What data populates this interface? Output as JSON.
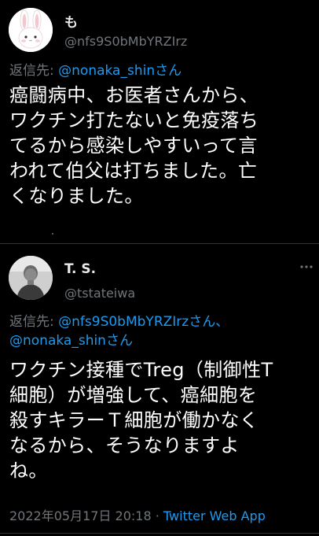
{
  "tweets": [
    {
      "display_name": "も",
      "handle": "@nfs9S0bMbYRZIrz",
      "reply_prefix": "返信先: ",
      "reply_mentions": "@nonaka_shinさん",
      "reply_mentions_2": "",
      "text": "癌闘病中、お医者さんから、\nワクチン打たないと免疫落ち\nてるから感染しやすいって言\nわれて伯父は打ちました。亡\nくなりました。"
    },
    {
      "display_name": "T. S.",
      "handle": "@tstateiwa",
      "reply_prefix": "返信先: ",
      "reply_mentions": "@nfs9S0bMbYRZIrzさん、",
      "reply_mentions_2": "@nonaka_shinさん",
      "text": "ワクチン接種でTreg（制御性T\n細胞）が増強して、癌細胞を\n殺すキラーＴ細胞が働かなく\nなるから、そうなりますよ\nね。",
      "timestamp": "2022年05月17日 20:18",
      "separator": " · ",
      "source": "Twitter Web App"
    }
  ],
  "colors": {
    "background": "#000000",
    "text": "#ffffff",
    "secondary": "#71767b",
    "link": "#1d9bf0",
    "divider": "#2f3336"
  },
  "icons": [
    "bunny-avatar-icon",
    "person-photo-avatar",
    "more-options-icon"
  ]
}
